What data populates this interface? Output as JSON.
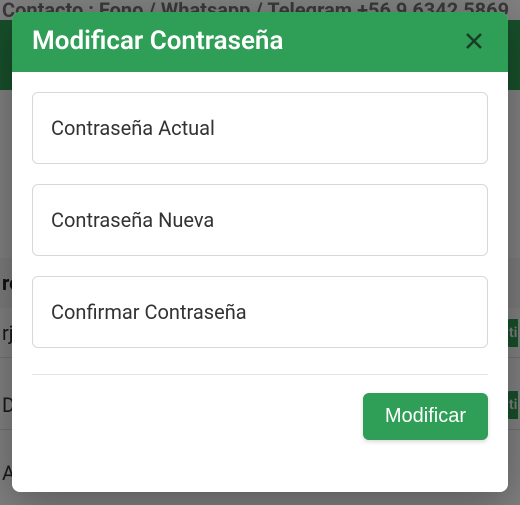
{
  "background": {
    "contact_line": "Contacto : Fono / Whatsapp / Telegram +56 9 6342 5869",
    "header_fragment": "re",
    "rows": [
      {
        "left": "rj",
        "badge": "ti"
      },
      {
        "left": "D",
        "badge": "ti"
      },
      {
        "left": "A",
        "badge": ""
      }
    ]
  },
  "modal": {
    "title": "Modificar Contraseña",
    "fields": {
      "current": {
        "label": "Contraseña Actual"
      },
      "new": {
        "label": "Contraseña Nueva"
      },
      "confirm": {
        "label": "Confirmar Contraseña"
      }
    },
    "submit_label": "Modificar"
  }
}
